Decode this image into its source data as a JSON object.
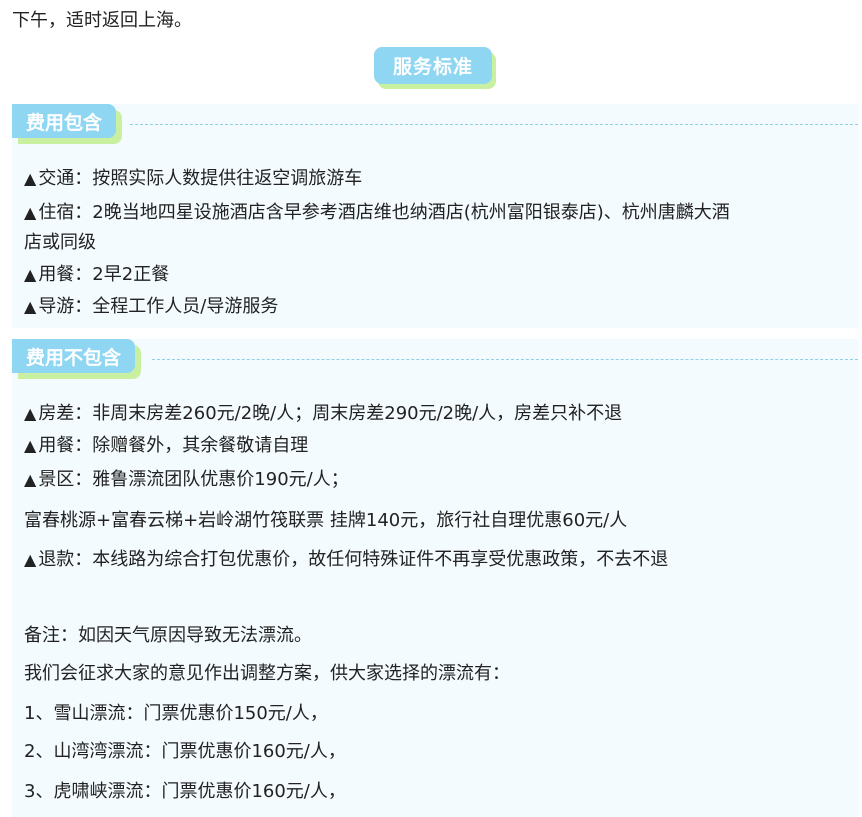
{
  "intro_text": "下午，适时返回上海。",
  "standard_tag": "服务标准",
  "included": {
    "tag": "费用包含",
    "lines": [
      "交通：按照实际人数提供往返空调旅游车",
      "住宿：2晚当地四星设施酒店含早参考酒店维也纳酒店(杭州富阳银泰店)、杭州唐麟大酒",
      "店或同级",
      "用餐：2早2正餐",
      "导游：全程工作人员/导游服务"
    ]
  },
  "excluded": {
    "tag": "费用不包含",
    "lines": [
      "房差：非周末房差260元/2晚/人；周末房差290元/2晚/人，房差只补不退",
      "用餐：除赠餐外，其余餐敬请自理",
      "景区：雅鲁漂流团队优惠价190元/人；",
      "富春桃源+富春云梯+岩岭湖竹筏联票 挂牌140元，旅行社自理优惠60元/人",
      "退款：本线路为综合打包优惠价，故任何特殊证件不再享受优惠政策，不去不退",
      "备注：如因天气原因导致无法漂流。",
      "我们会征求大家的意见作出调整方案，供大家选择的漂流有：",
      "1、雪山漂流：门票优惠价150元/人，",
      "2、山湾湾漂流：门票优惠价160元/人，",
      "3、虎啸峡漂流：门票优惠价160元/人，"
    ]
  },
  "bullet_glyph": "▲"
}
